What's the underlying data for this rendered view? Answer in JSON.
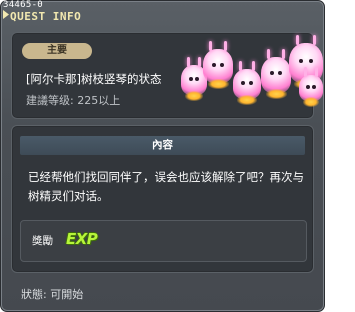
{
  "quest": {
    "id": "34465-0",
    "header_title": "QUEST INFO",
    "badge": "主要",
    "name": "[阿尔卡那]树枝竖琴的状态",
    "level": "建議等级: 225以上",
    "section_title": "內容",
    "description": "已经帮他们找回同伴了，误会也应该解除了吧？再次与树精灵们对话。",
    "reward_label": "獎勵",
    "reward_icon_text": "EXP",
    "status": "狀態:  可開始"
  },
  "colors": {
    "title": "#f2e8b0",
    "badge_bg": "#c9b78e",
    "exp": "#b6f53a"
  }
}
